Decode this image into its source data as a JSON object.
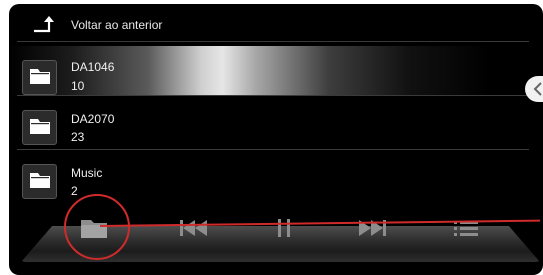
{
  "browser": {
    "back_label": "Voltar ao anterior",
    "back_icon": "return-arrow-icon",
    "folders": [
      {
        "name": "DA1046",
        "count": "10",
        "selected": true
      },
      {
        "name": "DA2070",
        "count": "23",
        "selected": false
      },
      {
        "name": "Music",
        "count": "2",
        "selected": false
      }
    ],
    "side_handle_icon": "chevron-left-icon"
  },
  "controls": {
    "buttons": [
      "folder-icon",
      "previous-track-icon",
      "pause-icon",
      "next-track-icon",
      "list-icon"
    ]
  },
  "annotation": {
    "color": "#cf2b2b"
  }
}
